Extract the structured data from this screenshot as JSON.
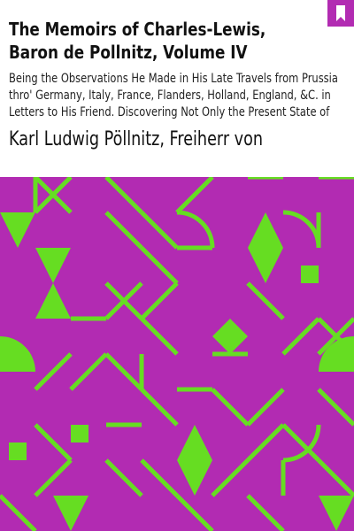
{
  "book": {
    "title": "The Memoirs of Charles-Lewis, Baron de Pollnitz, Volume IV",
    "subtitle": "Being the Observations He Made in His Late Travels from Prussia thro' Germany, Italy, France, Flanders, Holland, England, &C. in Letters to His Friend. Discovering Not Only the Present State of",
    "author": "Karl Ludwig Pöllnitz, Freiherr von"
  },
  "colors": {
    "art_background": "#b22bb2",
    "art_foreground": "#66dd22",
    "bookmark": "#b22bb2",
    "text": "#111111"
  },
  "icons": {
    "bookmark": "bookmark-icon"
  }
}
